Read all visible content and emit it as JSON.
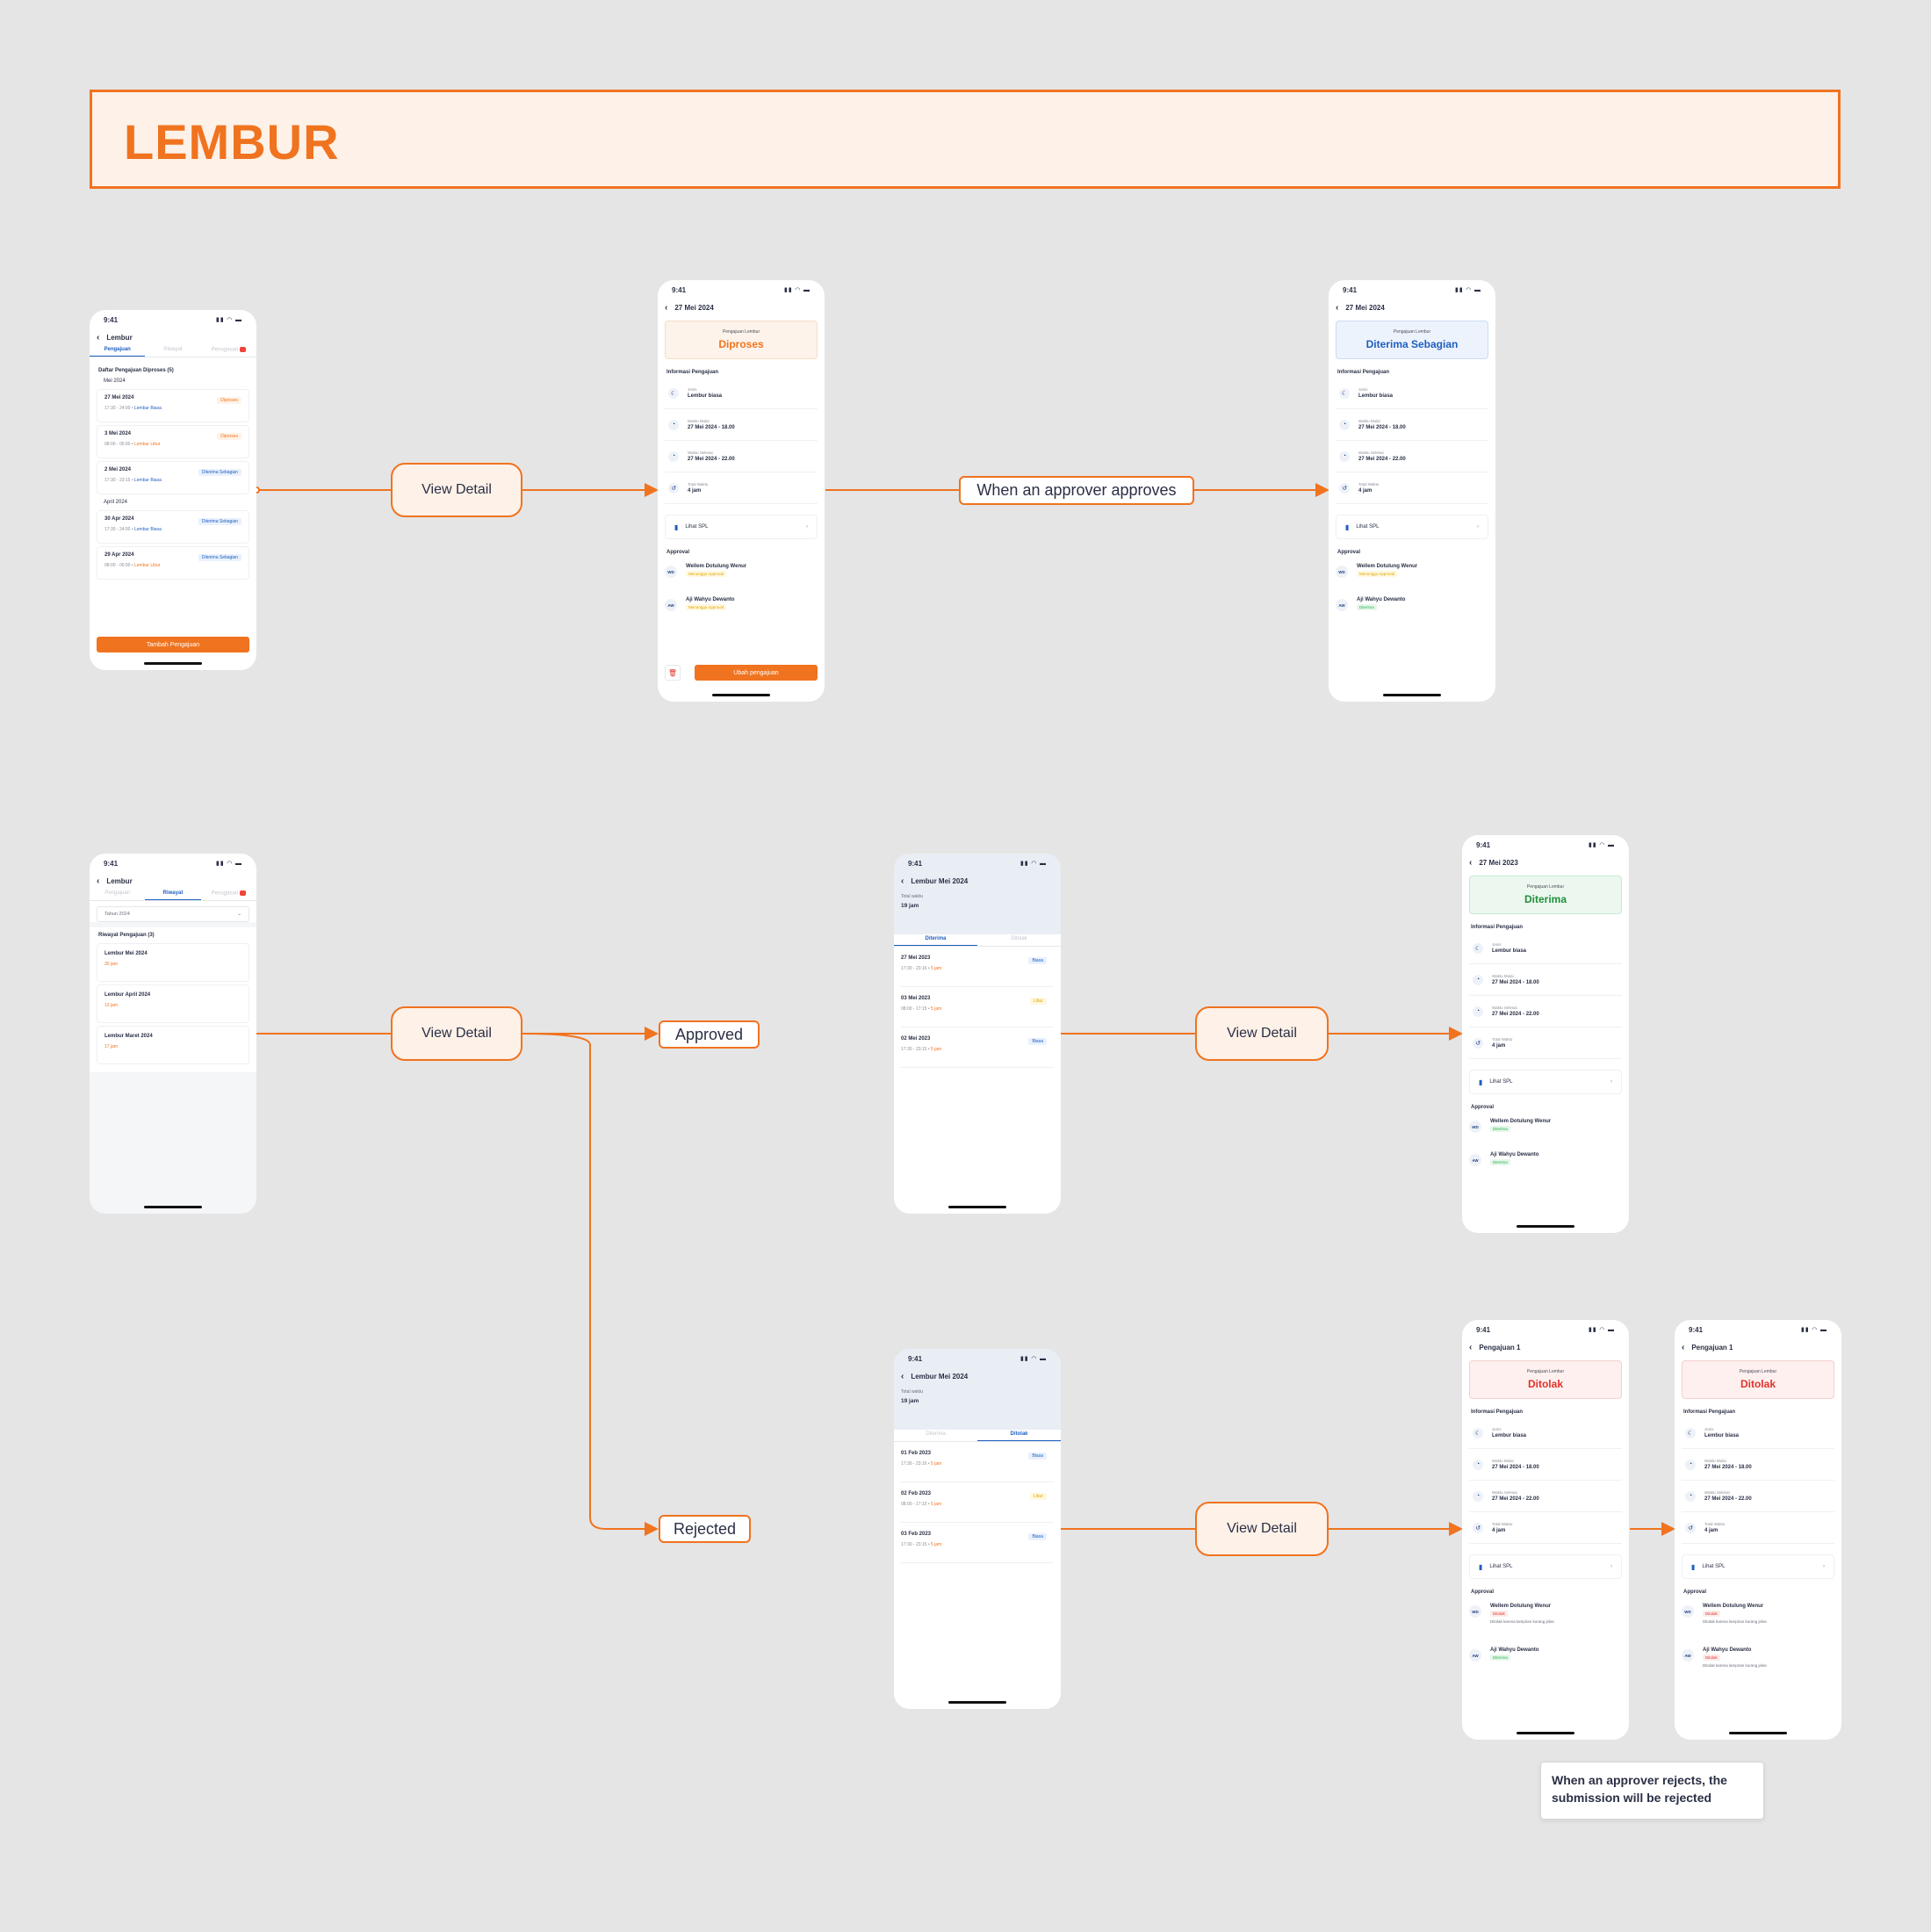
{
  "title": "LEMBUR",
  "flow": {
    "view_detail": "View Detail",
    "approves": "When an approver approves",
    "approved": "Approved",
    "rejected": "Rejected",
    "note": "When an approver rejects, the submission will be rejected"
  },
  "status_bar": {
    "time": "9:41"
  },
  "list_screen": {
    "title": "Lembur",
    "tabs": [
      "Pengajuan",
      "Riwayat",
      "Penugasan"
    ],
    "section": "Daftar Pengajuan Diproses (5)",
    "months": [
      "Mei 2024",
      "April 2024"
    ],
    "items": [
      {
        "date": "27 Mei 2024",
        "time": "17:30 - 24:00",
        "type": "Lembur Biasa",
        "status": "Diproses"
      },
      {
        "date": "3 Mei 2024",
        "time": "08:00 - 05:00",
        "type": "Lembur Libur",
        "status": "Diproses"
      },
      {
        "date": "2 Mei 2024",
        "time": "17:30 - 23:15",
        "type": "Lembur Biasa",
        "status": "Diterima Sebagian"
      },
      {
        "date": "30 Apr 2024",
        "time": "17:30 - 24:00",
        "type": "Lembur Biasa",
        "status": "Diterima Sebagian"
      },
      {
        "date": "29 Apr 2024",
        "time": "08:00 - 05:00",
        "type": "Lembur Libur",
        "status": "Diterima Sebagian"
      }
    ],
    "add_button": "Tambah Pengajuan"
  },
  "detail": {
    "date_title": "27 Mei 2024",
    "date_title_2023": "27 Mei 2023",
    "pengajuan_title": "Pengajuan 1",
    "status_label": "Pengajuan Lembur",
    "status_diproses": "Diproses",
    "status_sebagian": "Diterima Sebagian",
    "status_diterima": "Diterima",
    "status_ditolak": "Ditolak",
    "info_heading": "Informasi Pengajuan",
    "jenis_label": "Jenis",
    "jenis_value": "Lembur biasa",
    "mulai_label": "Waktu Mulai",
    "mulai_value": "27 Mei 2024 - 18.00",
    "selesai_label": "Waktu Selesai",
    "selesai_value": "27 Mei 2024 - 22.00",
    "total_label": "Total Waktu",
    "total_value": "4 jam",
    "spl": "Lihat SPL",
    "approval_heading": "Approval",
    "approver1": {
      "initials": "WD",
      "name": "Wellem Dotulung Wenur"
    },
    "approver2": {
      "initials": "AW",
      "name": "Aji Wahyu Dewanto"
    },
    "menunggu": "Menunggu Approval",
    "diterima": "Diterima",
    "ditolak": "Ditolak",
    "reason": "Ditolak karena lampiran kurang jelas",
    "ubah_button": "Ubah pengajuan"
  },
  "history_screen": {
    "title": "Lembur",
    "tabs": [
      "Pengajuan",
      "Riwayat",
      "Penugasan"
    ],
    "filter": "Tahun 2024",
    "section": "Riwayat Pengajuan (3)",
    "items": [
      {
        "name": "Lembur Mei 2024",
        "hours": "30 jam"
      },
      {
        "name": "Lembur April 2024",
        "hours": "13 jam"
      },
      {
        "name": "Lembur Maret 2024",
        "hours": "17 jam"
      }
    ]
  },
  "month_screen": {
    "title": "Lembur Mei 2024",
    "total_label": "Total waktu",
    "total_value": "19 jam",
    "tabs": [
      "Diterima",
      "Ditolak"
    ],
    "approved_items": [
      {
        "date": "27 Mei 2023",
        "time": "17:30 - 23:16",
        "hours": "5 jam",
        "type": "Biasa"
      },
      {
        "date": "03 Mei 2023",
        "time": "08:00 - 17:15",
        "hours": "5 jam",
        "type": "Libur"
      },
      {
        "date": "02 Mei 2023",
        "time": "17:30 - 23:15",
        "hours": "5 jam",
        "type": "Biasa"
      }
    ],
    "rejected_items": [
      {
        "date": "01 Feb 2023",
        "time": "17:30 - 23:16",
        "hours": "5 jam",
        "type": "Biasa"
      },
      {
        "date": "02 Feb 2023",
        "time": "08:00 - 17:15",
        "hours": "5 jam",
        "type": "Libur"
      },
      {
        "date": "03 Feb 2023",
        "time": "17:30 - 23:15",
        "hours": "5 jam",
        "type": "Biasa"
      }
    ]
  },
  "colors": {
    "accent": "#f0731f",
    "blue": "#1f5fbf",
    "green": "#1f8f3a",
    "red": "#e0342b",
    "background": "#e5e5e5"
  }
}
